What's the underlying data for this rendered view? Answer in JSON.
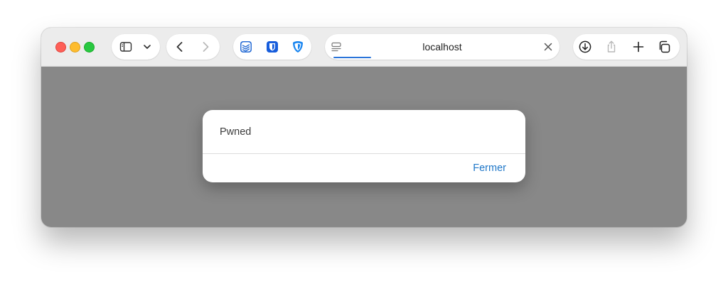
{
  "window": {
    "traffic_lights": {
      "close": "#fe5f57",
      "minimize": "#febc2e",
      "maximize": "#28c840"
    },
    "content_background": "#888888"
  },
  "toolbar": {
    "sidebar_icon": "sidebar-icon",
    "tab_menu_icon": "chevron-down-icon",
    "back_icon": "chevron-left-icon",
    "forward_icon": "chevron-right-icon",
    "extensions": [
      "todoist-extension-icon",
      "bitwarden-extension-icon",
      "adguard-extension-icon"
    ],
    "extension_colors": [
      "#2b6fd6",
      "#175ddc",
      "#1b86f0"
    ],
    "address": {
      "text": "localhost",
      "page_icon": "page-menu-icon",
      "stop_icon": "close-icon",
      "loading_progress": 0.16,
      "progress_color": "#2a74d9"
    },
    "download_icon": "download-icon",
    "share_icon": "share-icon",
    "new_tab_icon": "plus-icon",
    "tab_overview_icon": "tab-overview-icon"
  },
  "dialog": {
    "message": "Pwned",
    "button_label": "Fermer",
    "button_color": "#1f77c8"
  }
}
